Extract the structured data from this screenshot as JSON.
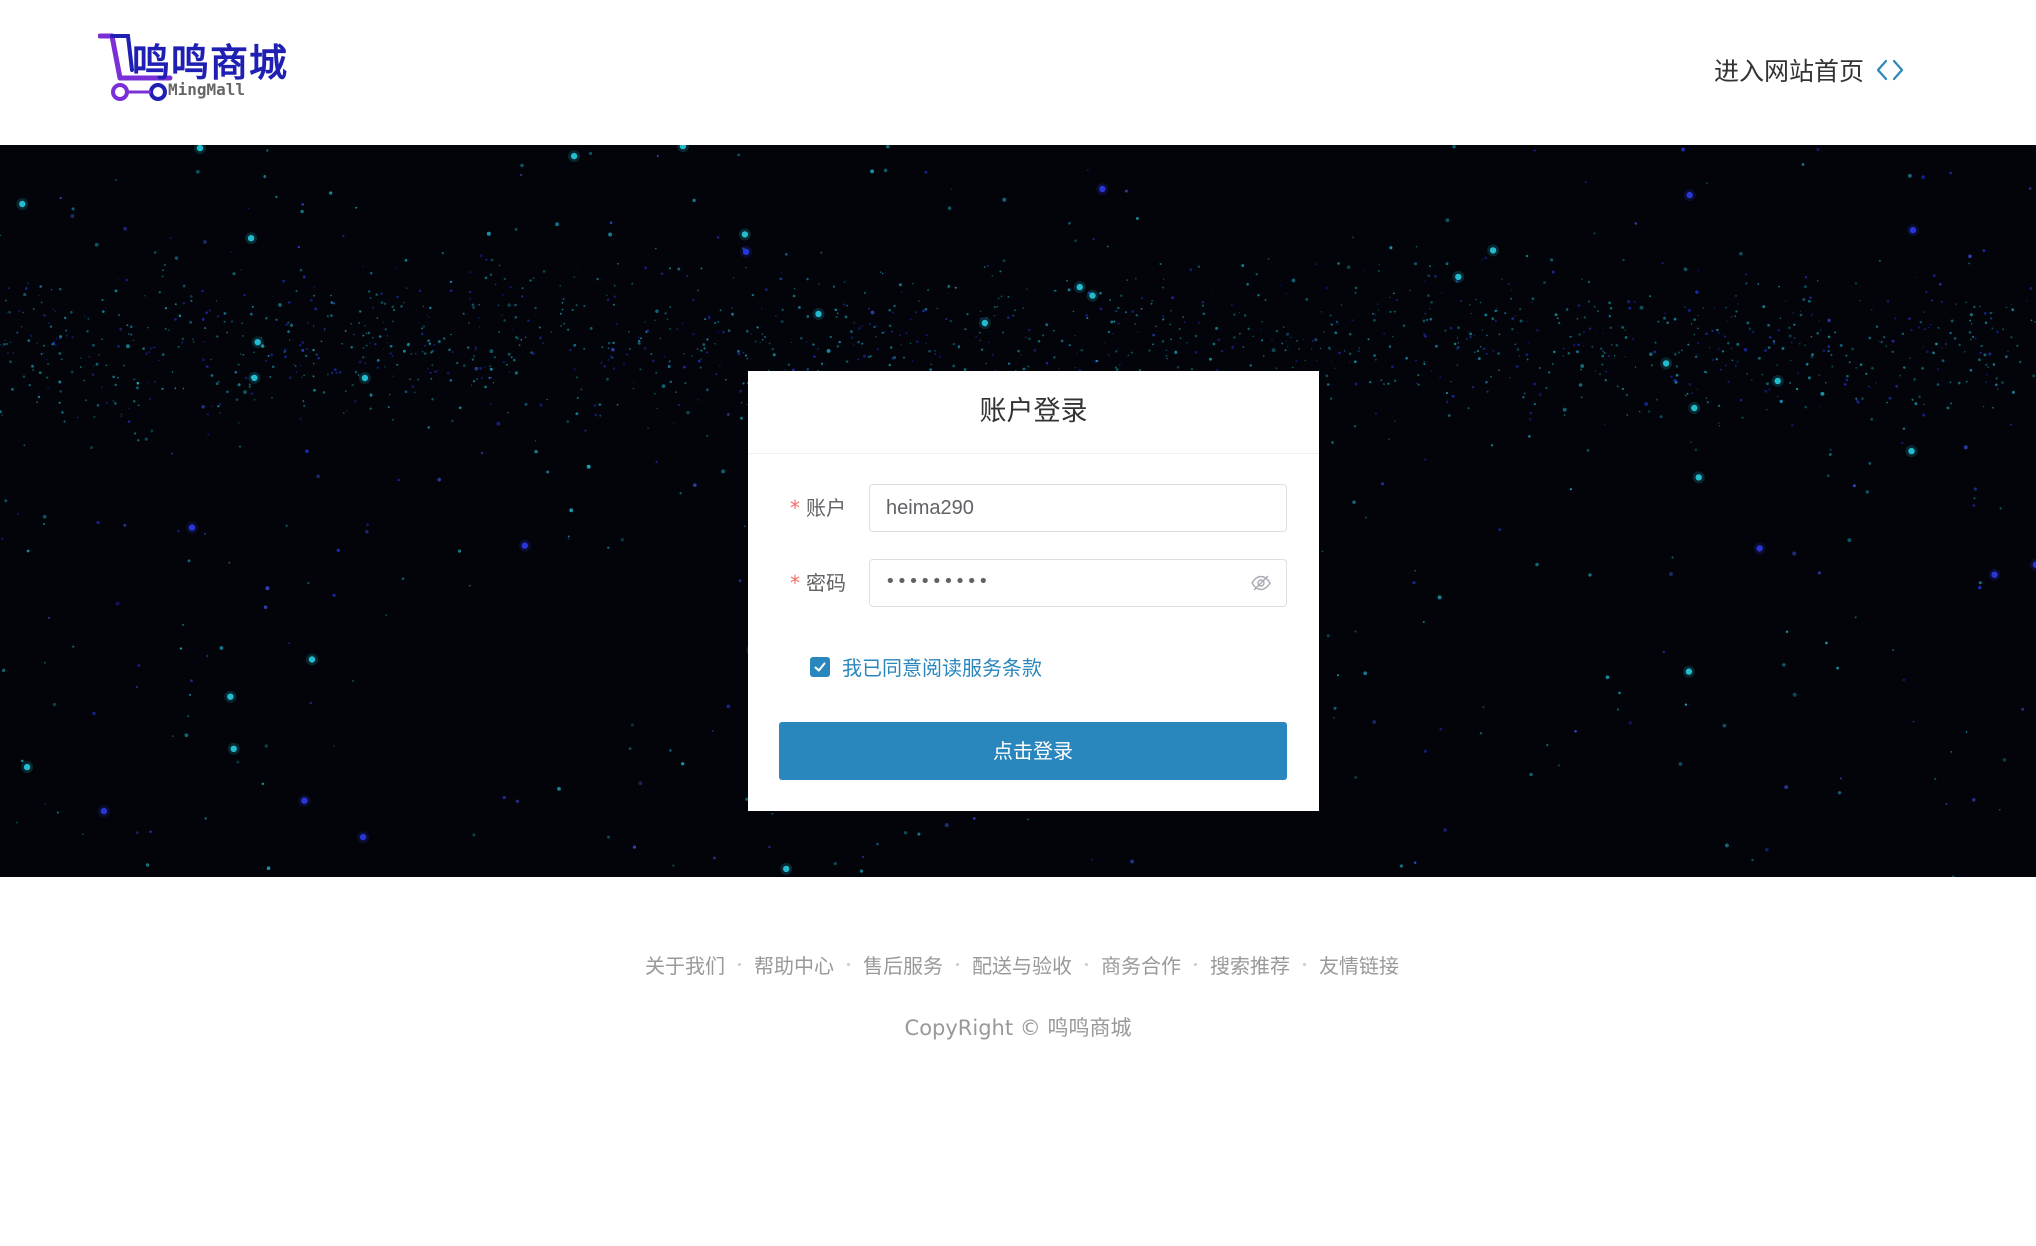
{
  "header": {
    "logo_text_cn": "鸣鸣商城",
    "logo_text_en": "MingMall",
    "home_link_label": "进入网站首页"
  },
  "login": {
    "title": "账户登录",
    "account_label": "账户",
    "account_value": "heima290",
    "password_label": "密码",
    "password_masked": "•••••••••",
    "agree_checked": true,
    "agree_label": "我已同意阅读服务条款",
    "submit_label": "点击登录"
  },
  "footer": {
    "links": [
      "关于我们",
      "帮助中心",
      "售后服务",
      "配送与验收",
      "商务合作",
      "搜索推荐",
      "友情链接"
    ],
    "copyright": "CopyRight © 鸣鸣商城"
  },
  "colors": {
    "accent": "#2a87bd",
    "logo_blue": "#1f1fb4",
    "logo_purple": "#7b2fd6",
    "required_star": "#f56c6c",
    "hero_background": "#02040a"
  },
  "icons": {
    "home_link": "code-brackets-icon",
    "password_toggle": "eye-off-icon",
    "agree": "checkbox-checked-icon",
    "logo": "shopping-cart-icon"
  }
}
